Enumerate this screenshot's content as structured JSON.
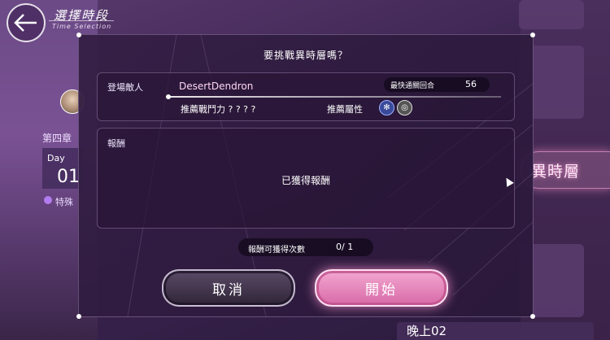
{
  "header": {
    "title": "選擇時段",
    "subtitle": "Time Selection"
  },
  "background": {
    "chapter": "第四章",
    "day_label": "Day",
    "day_number": "01",
    "special_label": "特殊",
    "right_highlight": "異時層",
    "bottom_right_label": "晚上02"
  },
  "dialog": {
    "title": "要挑戰異時層嗎？",
    "enemy_label": "登場敵人",
    "enemy_name": "DesertDendron",
    "fastest_label": "最快通關回合",
    "fastest_value": "56",
    "power_label": "推薦戰鬥力 ? ? ? ?",
    "attribute_label": "推薦屬性",
    "attribute_icons": [
      "snowflake-icon",
      "swirl-icon"
    ],
    "reward_label": "報酬",
    "reward_status": "已獲得報酬",
    "reward_count_label": "報酬可獲得次數",
    "reward_count_value": "0/ 1",
    "cancel_label": "取消",
    "start_label": "開始"
  },
  "colors": {
    "accent_pink": "#f3a7d0",
    "panel_bg": "#2a1838"
  }
}
